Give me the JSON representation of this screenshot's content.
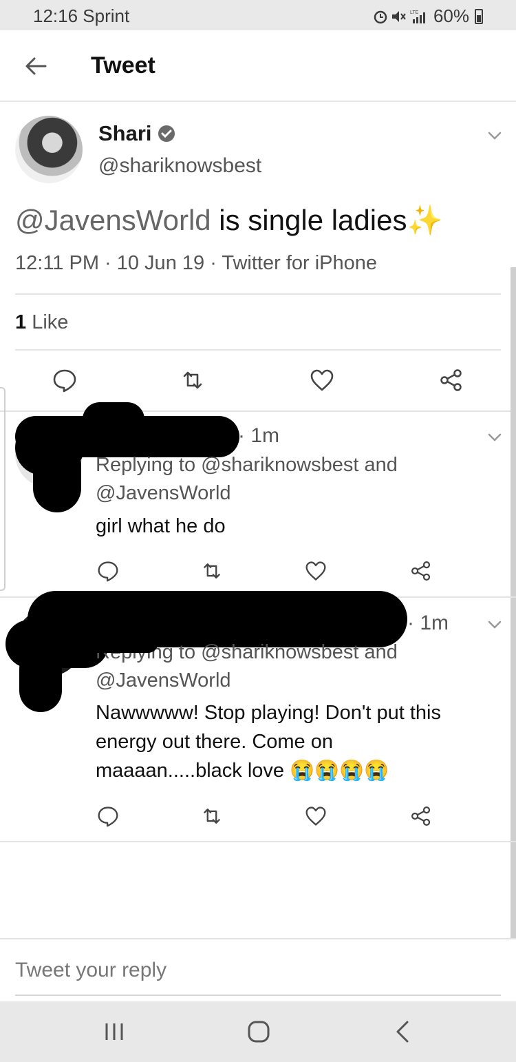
{
  "status_bar": {
    "time": "12:16 Sprint",
    "battery": "60%",
    "icons": [
      "alarm-icon",
      "mute-icon",
      "lte-signal-icon",
      "battery-icon"
    ]
  },
  "header": {
    "title": "Tweet",
    "back_icon": "arrow-left-icon"
  },
  "tweet": {
    "author_name": "Shari",
    "verified": true,
    "handle": "@shariknowsbest",
    "mention": "@JavensWorld",
    "text": " is single ladies",
    "emoji": "✨",
    "meta": "12:11 PM · 10 Jun 19 · Twitter for iPhone",
    "likes_count": "1",
    "likes_label": "Like",
    "actions": [
      "reply-icon",
      "retweet-icon",
      "like-icon",
      "share-icon"
    ]
  },
  "replies": [
    {
      "time": "· 1m",
      "replying_to_line1": "Replying to @shariknowsbest and",
      "replying_to_line2": "@JavensWorld",
      "text_lines": [
        "girl what he do"
      ]
    },
    {
      "time": "· 1m",
      "replying_to_line1": "Replying to @shariknowsbest and",
      "replying_to_line2": "@JavensWorld",
      "text_lines": [
        "Nawwwww! Stop playing! Don't put this",
        "energy out there. Come on",
        "maaaan.....black love 😭😭😭😭"
      ]
    }
  ],
  "composer": {
    "placeholder": "Tweet your reply"
  },
  "colors": {
    "text": "#111111",
    "secondary": "#555555",
    "divider": "#e3e3e3",
    "status_bar": "#e9e9e9",
    "nav_bar": "#e8e8e8"
  }
}
